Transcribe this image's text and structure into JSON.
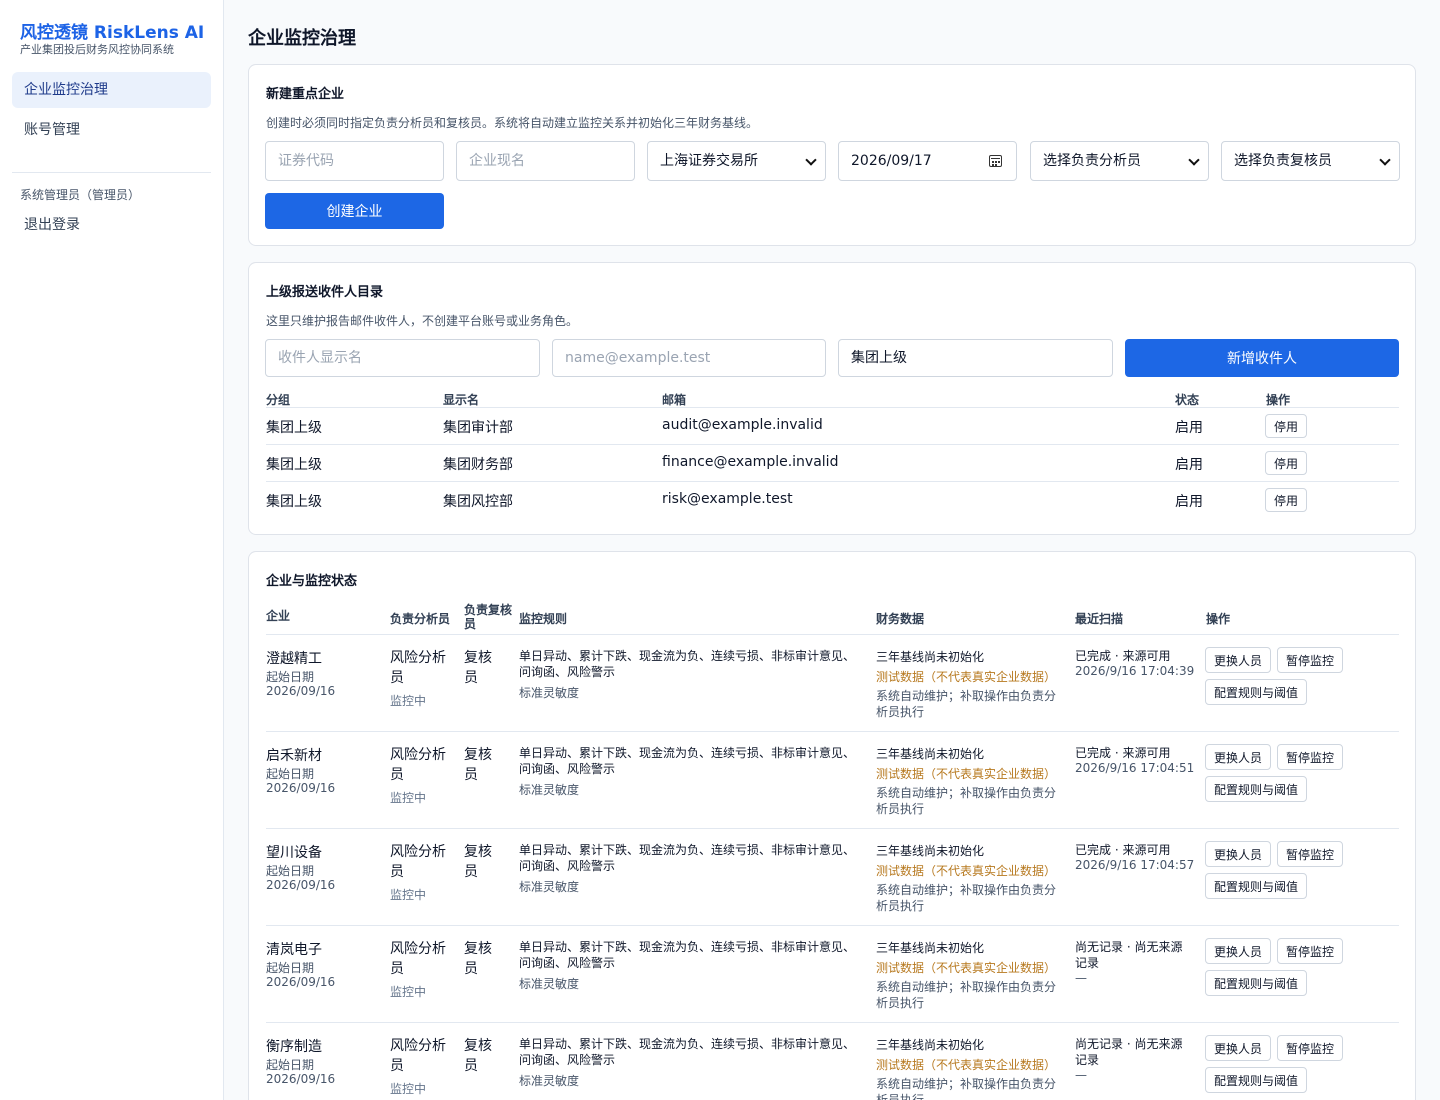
{
  "app": {
    "brand": "风控透镜 RiskLens AI",
    "subtitle": "产业集团投后财务风控协同系统"
  },
  "sidebar": {
    "items": [
      {
        "label": "企业监控治理"
      },
      {
        "label": "账号管理"
      }
    ],
    "user_role": "系统管理员（管理员）",
    "logout": "退出登录"
  },
  "page": {
    "title": "企业监控治理"
  },
  "create_card": {
    "title": "新建重点企业",
    "desc": "创建时必须同时指定负责分析员和复核员。系统将自动建立监控关系并初始化三年财务基线。",
    "code_placeholder": "证券代码",
    "name_placeholder": "企业现名",
    "exchange": "上海证券交易所",
    "date": "2026/09/17",
    "analyst_select": "选择负责分析员",
    "reviewer_select": "选择负责复核员",
    "submit": "创建企业"
  },
  "recipient_card": {
    "title": "上级报送收件人目录",
    "desc": "这里只维护报告邮件收件人，不创建平台账号或业务角色。",
    "name_placeholder": "收件人显示名",
    "email_placeholder": "name@example.test",
    "group_value": "集团上级",
    "add_button": "新增收件人",
    "headers": [
      "分组",
      "显示名",
      "邮箱",
      "状态",
      "操作"
    ],
    "rows": [
      {
        "group": "集团上级",
        "name": "集团审计部",
        "email": "audit@example.invalid",
        "status": "启用",
        "action": "停用"
      },
      {
        "group": "集团上级",
        "name": "集团财务部",
        "email": "finance@example.invalid",
        "status": "启用",
        "action": "停用"
      },
      {
        "group": "集团上级",
        "name": "集团风控部",
        "email": "risk@example.test",
        "status": "启用",
        "action": "停用"
      }
    ]
  },
  "company_card": {
    "title": "企业与监控状态",
    "headers": {
      "company": "企业",
      "analyst": "负责分析员",
      "reviewer": "负责复核员",
      "rules": "监控规则",
      "finance": "财务数据",
      "scan": "最近扫描",
      "actions": "操作"
    },
    "rows": [
      {
        "name": "澄越精工",
        "start_label": "起始日期",
        "start_date": "2026/09/16",
        "analyst": "风险分析员",
        "status": "监控中",
        "reviewer": "复核员",
        "rules": "单日异动、累计下跌、现金流为负、连续亏损、非标审计意见、问询函、风险警示",
        "sensitivity": "标准灵敏度",
        "fin_baseline": "三年基线尚未初始化",
        "fin_test": "测试数据（不代表真实企业数据）",
        "fin_note": "系统自动维护；补取操作由负责分析员执行",
        "scan_status": "已完成 · 来源可用",
        "scan_time": "2026/9/16 17:04:39",
        "btn_change": "更换人员",
        "btn_pause": "暂停监控",
        "btn_config": "配置规则与阈值"
      },
      {
        "name": "启禾新材",
        "start_label": "起始日期",
        "start_date": "2026/09/16",
        "analyst": "风险分析员",
        "status": "监控中",
        "reviewer": "复核员",
        "rules": "单日异动、累计下跌、现金流为负、连续亏损、非标审计意见、问询函、风险警示",
        "sensitivity": "标准灵敏度",
        "fin_baseline": "三年基线尚未初始化",
        "fin_test": "测试数据（不代表真实企业数据）",
        "fin_note": "系统自动维护；补取操作由负责分析员执行",
        "scan_status": "已完成 · 来源可用",
        "scan_time": "2026/9/16 17:04:51",
        "btn_change": "更换人员",
        "btn_pause": "暂停监控",
        "btn_config": "配置规则与阈值"
      },
      {
        "name": "望川设备",
        "start_label": "起始日期",
        "start_date": "2026/09/16",
        "analyst": "风险分析员",
        "status": "监控中",
        "reviewer": "复核员",
        "rules": "单日异动、累计下跌、现金流为负、连续亏损、非标审计意见、问询函、风险警示",
        "sensitivity": "标准灵敏度",
        "fin_baseline": "三年基线尚未初始化",
        "fin_test": "测试数据（不代表真实企业数据）",
        "fin_note": "系统自动维护；补取操作由负责分析员执行",
        "scan_status": "已完成 · 来源可用",
        "scan_time": "2026/9/16 17:04:57",
        "btn_change": "更换人员",
        "btn_pause": "暂停监控",
        "btn_config": "配置规则与阈值"
      },
      {
        "name": "清岚电子",
        "start_label": "起始日期",
        "start_date": "2026/09/16",
        "analyst": "风险分析员",
        "status": "监控中",
        "reviewer": "复核员",
        "rules": "单日异动、累计下跌、现金流为负、连续亏损、非标审计意见、问询函、风险警示",
        "sensitivity": "标准灵敏度",
        "fin_baseline": "三年基线尚未初始化",
        "fin_test": "测试数据（不代表真实企业数据）",
        "fin_note": "系统自动维护；补取操作由负责分析员执行",
        "scan_status": "尚无记录 · 尚无来源记录",
        "scan_time": "—",
        "btn_change": "更换人员",
        "btn_pause": "暂停监控",
        "btn_config": "配置规则与阈值"
      },
      {
        "name": "衡序制造",
        "start_label": "起始日期",
        "start_date": "2026/09/16",
        "analyst": "风险分析员",
        "status": "监控中",
        "reviewer": "复核员",
        "rules": "单日异动、累计下跌、现金流为负、连续亏损、非标审计意见、问询函、风险警示",
        "sensitivity": "标准灵敏度",
        "fin_baseline": "三年基线尚未初始化",
        "fin_test": "测试数据（不代表真实企业数据）",
        "fin_note": "系统自动维护；补取操作由负责分析员执行",
        "scan_status": "尚无记录 · 尚无来源记录",
        "scan_time": "—",
        "btn_change": "更换人员",
        "btn_pause": "暂停监控",
        "btn_config": "配置规则与阈值"
      }
    ]
  },
  "colors": {
    "accent": "#1d67e5",
    "brand": "#1d63e6",
    "warning_text": "#b7791f",
    "nav_active_bg": "#eaf1fc"
  }
}
